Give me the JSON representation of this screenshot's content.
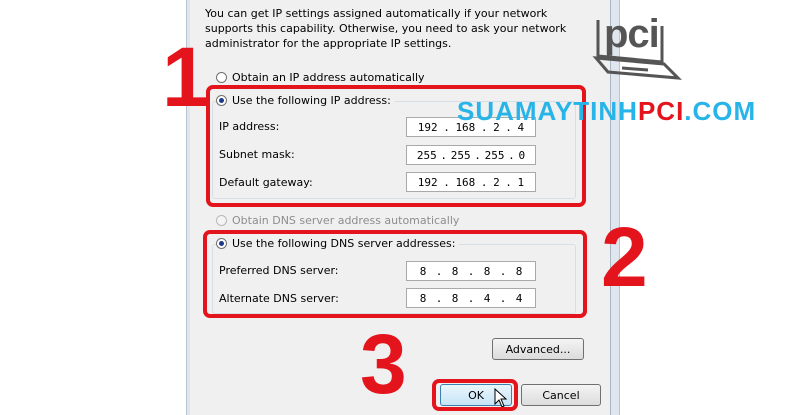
{
  "description": "You can get IP settings assigned automatically if your network supports this capability. Otherwise, you need to ask your network administrator for the appropriate IP settings.",
  "ip_section": {
    "auto_option": "Obtain an IP address automatically",
    "manual_option": "Use the following IP address:",
    "fields": [
      {
        "label": "IP address:",
        "octets": [
          "192",
          "168",
          "2",
          "4"
        ]
      },
      {
        "label": "Subnet mask:",
        "octets": [
          "255",
          "255",
          "255",
          "0"
        ]
      },
      {
        "label": "Default gateway:",
        "octets": [
          "192",
          "168",
          "2",
          "1"
        ]
      }
    ]
  },
  "dns_section": {
    "auto_option": "Obtain DNS server address automatically",
    "manual_option": "Use the following DNS server addresses:",
    "fields": [
      {
        "label": "Preferred DNS server:",
        "octets": [
          "8",
          "8",
          "8",
          "8"
        ]
      },
      {
        "label": "Alternate DNS server:",
        "octets": [
          "8",
          "8",
          "4",
          "4"
        ]
      }
    ]
  },
  "buttons": {
    "advanced": "Advanced...",
    "ok": "OK",
    "cancel": "Cancel"
  },
  "steps": [
    "1",
    "2",
    "3"
  ],
  "watermark": {
    "part1": "SUAMAYTINH",
    "part2": "PCI",
    "part3": ".COM"
  },
  "logo_text": "pci",
  "colors": {
    "highlight_red": "#e4141c",
    "watermark_blue": "#27b4e8"
  }
}
